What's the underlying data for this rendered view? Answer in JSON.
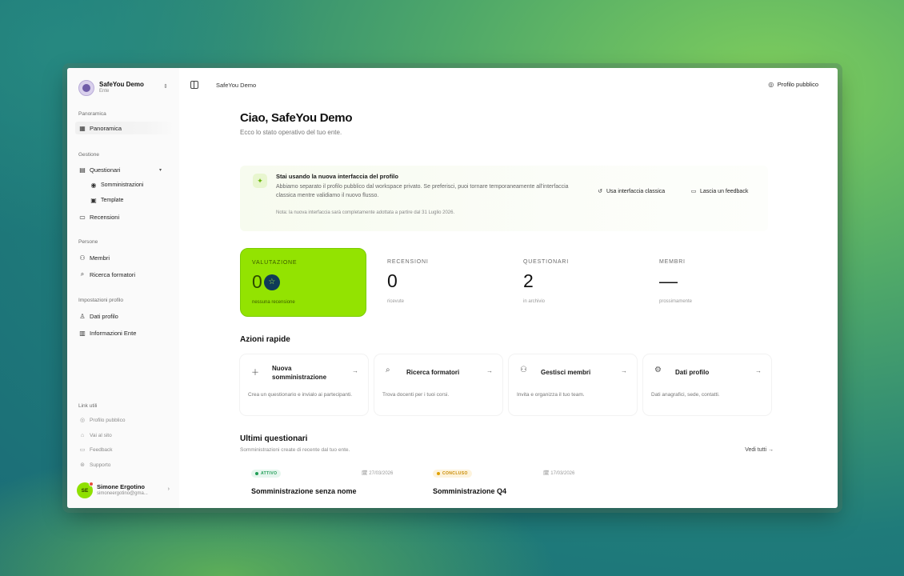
{
  "workspace": {
    "name": "SafeYou Demo",
    "type": "Ente"
  },
  "sidebar": {
    "sections": [
      {
        "label": "Panoramica"
      },
      {
        "label": "Gestione"
      },
      {
        "label": "Persone"
      },
      {
        "label": "Impostazioni profilo"
      }
    ],
    "items": {
      "panoramica": "Panoramica",
      "questionari": "Questionari",
      "somministrazioni": "Somministrazioni",
      "template": "Template",
      "recensioni": "Recensioni",
      "membri": "Membri",
      "ricerca_formatori": "Ricerca formatori",
      "dati_profilo": "Dati profilo",
      "informazioni_ente": "Informazioni Ente"
    },
    "links_label": "Link utili",
    "links": [
      "Profilo pubblico",
      "Vai al sito",
      "Feedback",
      "Supporto"
    ],
    "user": {
      "initials": "SE",
      "name": "Simone Ergotino",
      "email": "simoneergotino@gma..."
    }
  },
  "topbar": {
    "breadcrumb": "SafeYou Demo",
    "public_profile": "Profilo pubblico"
  },
  "main": {
    "greeting": "Ciao, SafeYou Demo",
    "subtitle": "Ecco lo stato operativo del tuo ente.",
    "banner": {
      "title": "Stai usando la nuova interfaccia del profilo",
      "text": "Abbiamo separato il profilo pubblico dal workspace privato. Se preferisci, puoi tornare temporaneamente all'interfaccia classica mentre validiamo il nuovo flusso.",
      "note": "Nota: la nuova interfaccia sarà completamente adottata a partire dal 31 Luglio 2026.",
      "classic_button": "Usa interfaccia classica",
      "feedback_button": "Lascia un feedback"
    },
    "stats": [
      {
        "label": "VALUTAZIONE",
        "value": "0",
        "foot": "nessuna recensione"
      },
      {
        "label": "RECENSIONI",
        "value": "0",
        "foot": "ricevute"
      },
      {
        "label": "QUESTIONARI",
        "value": "2",
        "foot": "in archivio"
      },
      {
        "label": "MEMBRI",
        "value": "—",
        "foot": "prossimamente"
      }
    ],
    "quick_title": "Azioni rapide",
    "actions": [
      {
        "title": "Nuova somministrazione",
        "desc": "Crea un questionario e invialo ai partecipanti.",
        "icon": "plus-icon"
      },
      {
        "title": "Ricerca formatori",
        "desc": "Trova docenti per i tuoi corsi.",
        "icon": "search-icon"
      },
      {
        "title": "Gestisci membri",
        "desc": "Invita e organizza il tuo team.",
        "icon": "users-icon"
      },
      {
        "title": "Dati profilo",
        "desc": "Dati anagrafici, sede, contatti.",
        "icon": "gear-icon"
      }
    ],
    "recent_title": "Ultimi questionari",
    "recent_sub": "Somministrazioni create di recente dal tuo ente.",
    "see_all": "Vedi tutti →",
    "questionnaires": [
      {
        "status": "ATTIVO",
        "date": "27/03/2026",
        "title": "Somministrazione senza nome",
        "color": "#1f9d55",
        "bg": "#e6f6ee"
      },
      {
        "status": "CONCLUSO",
        "date": "17/03/2026",
        "title": "Somministrazione Q4",
        "color": "#c98a00",
        "bg": "#fdf3dc"
      }
    ]
  },
  "colors": {
    "accent": "#93e301",
    "badge_navy": "#0f3b58"
  }
}
